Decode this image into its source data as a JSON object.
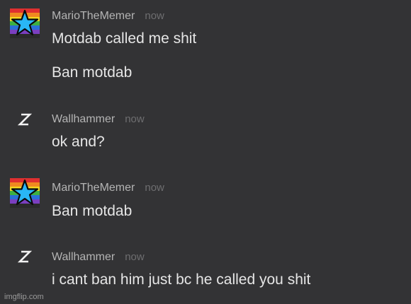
{
  "messages": [
    {
      "author": "MarioTheMemer",
      "time": "now",
      "avatar": "rainbow-star-icon",
      "lines": [
        "Motdab called me shit",
        "Ban motdab"
      ]
    },
    {
      "author": "Wallhammer",
      "time": "now",
      "avatar": "lightning-bolt-icon",
      "lines": [
        "ok and?"
      ]
    },
    {
      "author": "MarioTheMemer",
      "time": "now",
      "avatar": "rainbow-star-icon",
      "lines": [
        "Ban motdab"
      ]
    },
    {
      "author": "Wallhammer",
      "time": "now",
      "avatar": "lightning-bolt-icon",
      "lines": [
        "i cant ban him just bc he called you shit"
      ]
    }
  ],
  "watermark": "imgflip.com",
  "colors": {
    "background": "#333335",
    "author": "#b4b4b4",
    "timestamp": "#6e6e70",
    "message_text": "#e6e6e6"
  }
}
